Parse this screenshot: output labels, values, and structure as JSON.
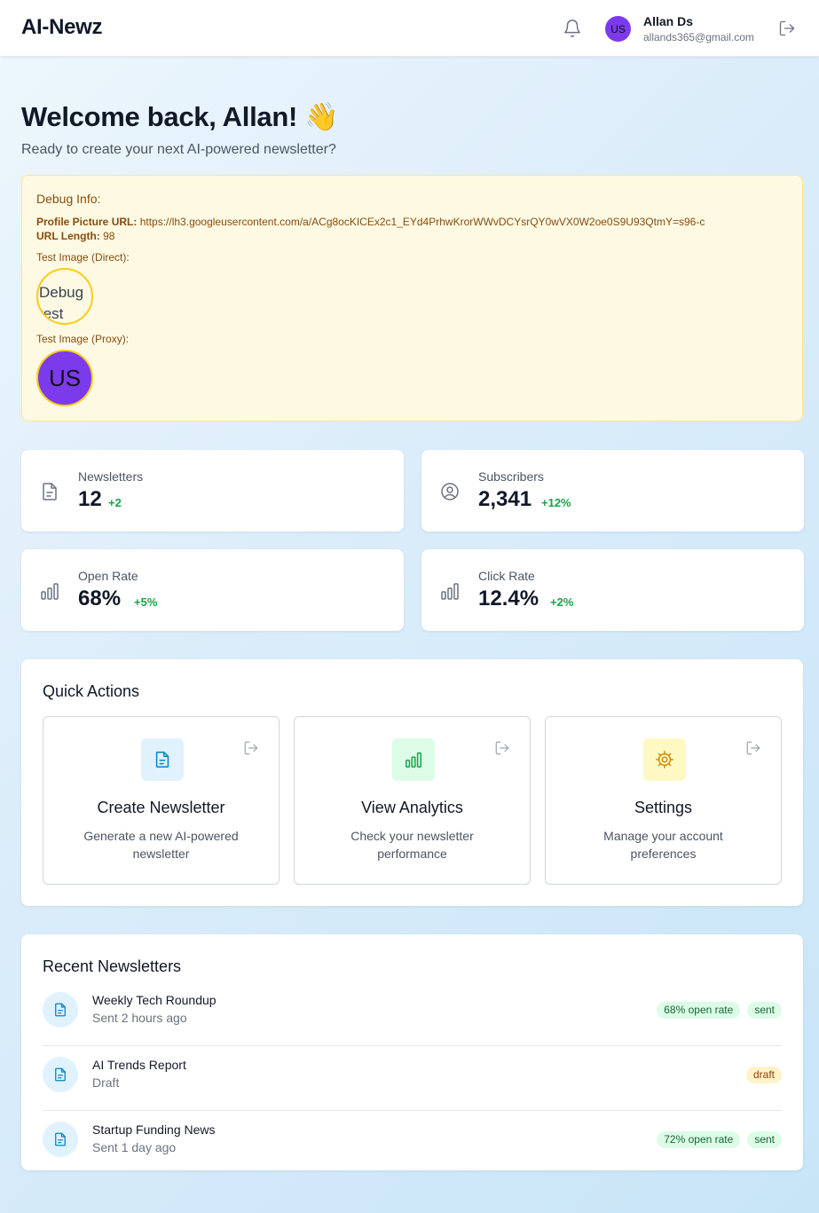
{
  "header": {
    "brand": "AI-Newz",
    "user": {
      "initials": "US",
      "name": "Allan Ds",
      "email": "allands365@gmail.com"
    }
  },
  "welcome": {
    "title": "Welcome back, Allan! 👋",
    "subtitle": "Ready to create your next AI-powered newsletter?"
  },
  "debug": {
    "title": "Debug Info:",
    "url_label": "Profile Picture URL:",
    "url_value": "https://lh3.googleusercontent.com/a/ACg8ocKICEx2c1_EYd4PrhwKrorWWvDCYsrQY0wVX0W2oe0S9U93QtmY=s96-c",
    "length_label": "URL Length:",
    "length_value": "98",
    "direct_label": "Test Image (Direct):",
    "direct_alt": "Debug test",
    "proxy_label": "Test Image (Proxy):",
    "proxy_initials": "US"
  },
  "stats": [
    {
      "label": "Newsletters",
      "value": "12",
      "change": "+2",
      "icon": "document-icon"
    },
    {
      "label": "Subscribers",
      "value": "2,341",
      "change": "+12%",
      "icon": "user-circle-icon"
    },
    {
      "label": "Open Rate",
      "value": "68%",
      "change": "+5%",
      "icon": "bar-chart-icon"
    },
    {
      "label": "Click Rate",
      "value": "12.4%",
      "change": "+2%",
      "icon": "bar-chart-icon"
    }
  ],
  "quick_actions": {
    "title": "Quick Actions",
    "items": [
      {
        "title": "Create Newsletter",
        "desc": "Generate a new AI-powered newsletter",
        "icon": "document-icon",
        "color": "#0284c7",
        "bg": "#e0f2fe"
      },
      {
        "title": "View Analytics",
        "desc": "Check your newsletter performance",
        "icon": "bar-chart-icon",
        "color": "#16a34a",
        "bg": "#dcfce7"
      },
      {
        "title": "Settings",
        "desc": "Manage your account preferences",
        "icon": "gear-icon",
        "color": "#ca8a04",
        "bg": "#fef9c3"
      }
    ]
  },
  "recent": {
    "title": "Recent Newsletters",
    "items": [
      {
        "title": "Weekly Tech Roundup",
        "sub": "Sent 2 hours ago",
        "rate": "68% open rate",
        "status": "sent"
      },
      {
        "title": "AI Trends Report",
        "sub": "Draft",
        "rate": "",
        "status": "draft"
      },
      {
        "title": "Startup Funding News",
        "sub": "Sent 1 day ago",
        "rate": "72% open rate",
        "status": "sent"
      }
    ]
  },
  "colors": {
    "accent_purple": "#7c3aed",
    "success_green": "#16a34a",
    "debug_bg": "#fef9e3"
  }
}
